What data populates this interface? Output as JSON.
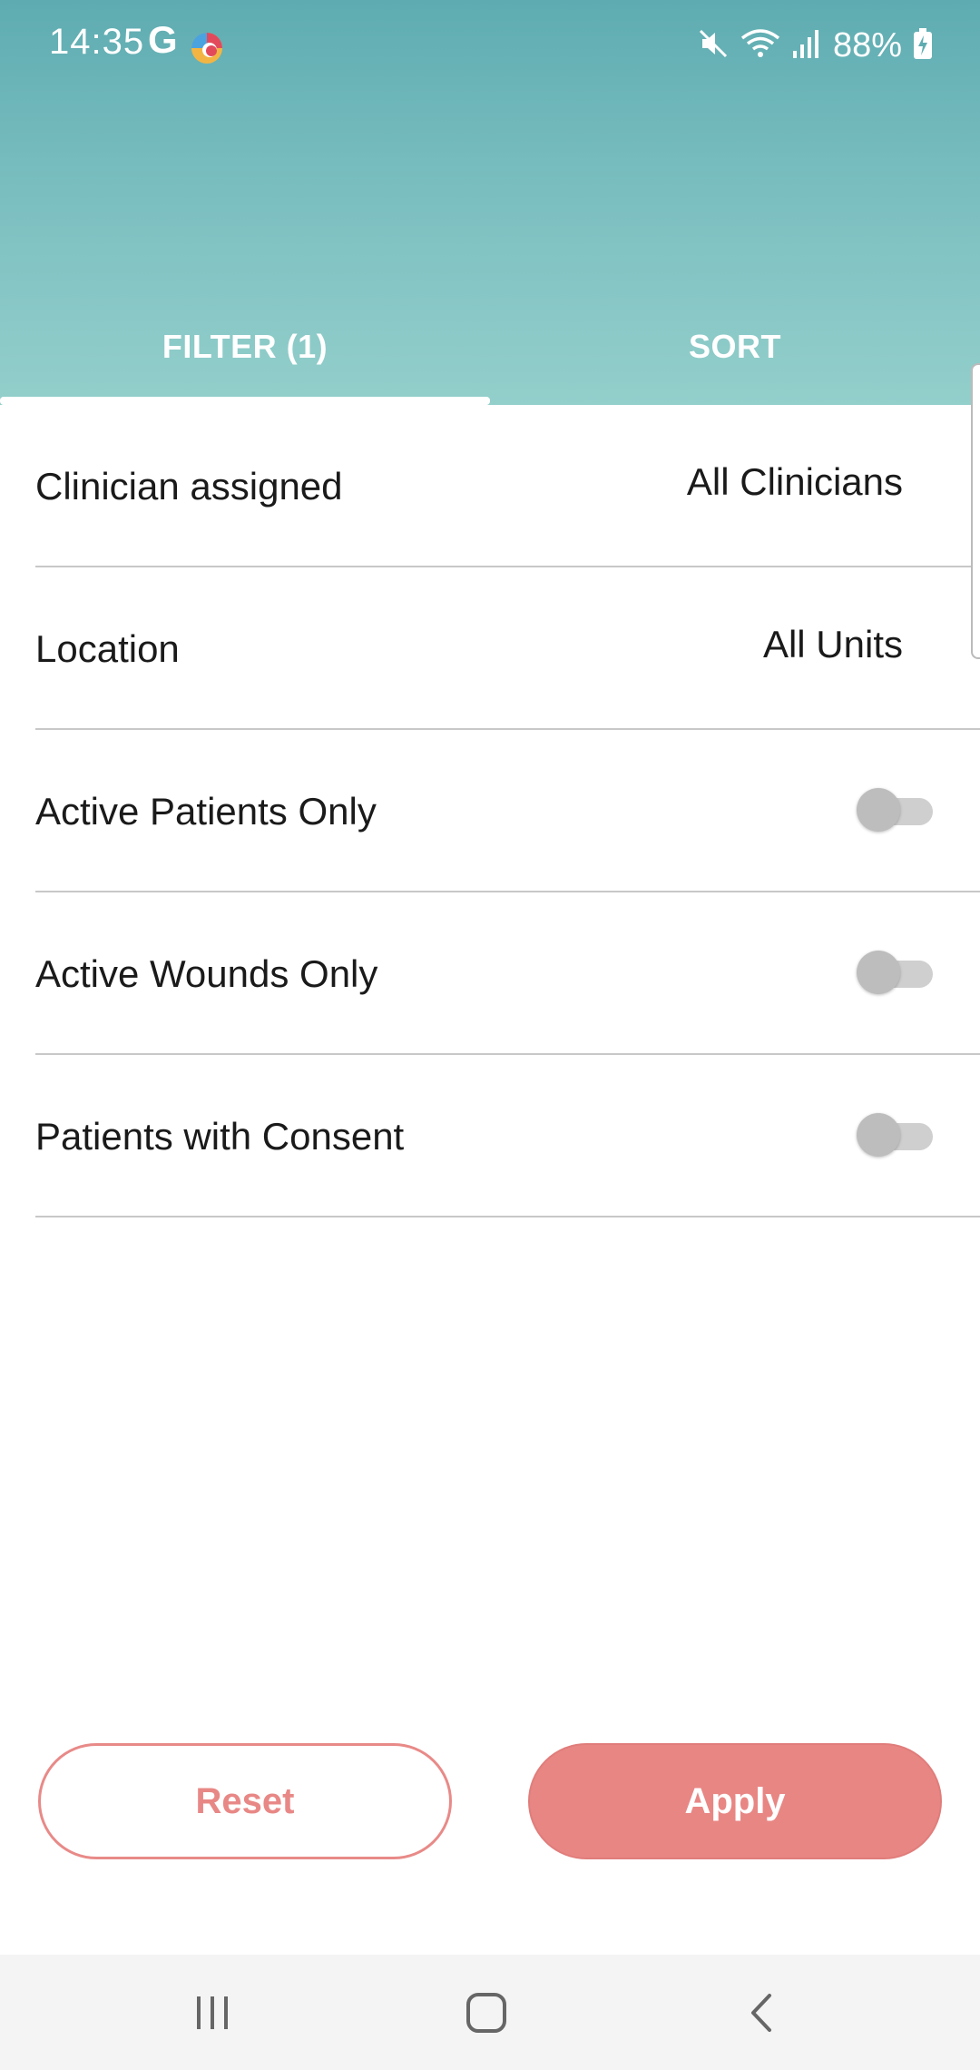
{
  "status_bar": {
    "time": "14:35",
    "g_label": "G",
    "battery": "88%"
  },
  "tabs": [
    {
      "label": "FILTER (1)",
      "selected": true
    },
    {
      "label": "SORT",
      "selected": false
    }
  ],
  "filters": {
    "clinician": {
      "label": "Clinician assigned",
      "value": "All Clinicians"
    },
    "location": {
      "label": "Location",
      "value": "All Units"
    },
    "active_patients": {
      "label": "Active Patients Only",
      "on": false
    },
    "active_wounds": {
      "label": "Active Wounds Only",
      "on": false
    },
    "consent": {
      "label": "Patients with Consent",
      "on": false
    }
  },
  "buttons": {
    "reset": "Reset",
    "apply": "Apply"
  },
  "colors": {
    "header_top": "#5eacb1",
    "header_bottom": "#93cfcb",
    "accent": "#e88684"
  }
}
